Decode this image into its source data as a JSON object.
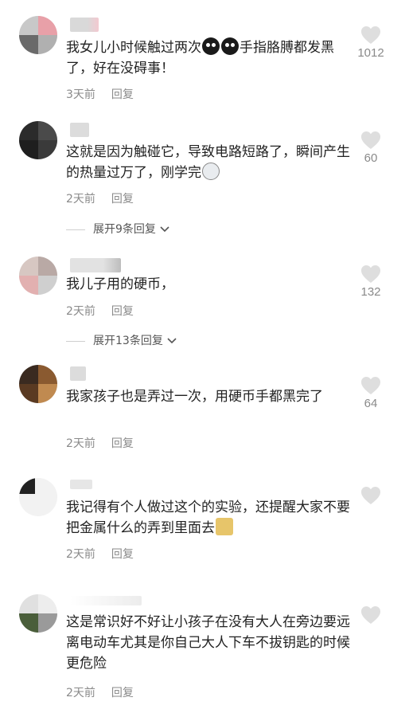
{
  "comments": [
    {
      "text_a": "我女儿小时候触过两次",
      "emoji_a": "crying-face-icon",
      "emoji_b": "crying-face-icon",
      "text_b": "手指胳膊都发黑了，好在没碍事！",
      "time": "3天前",
      "reply": "回复",
      "likes": "1012"
    },
    {
      "text_a": "这就是因为触碰它，导致电路短路了，瞬间产生的热量过万了，刚学完",
      "emoji_a": "husky-face-icon",
      "time": "2天前",
      "reply": "回复",
      "likes": "60",
      "expand": "展开9条回复"
    },
    {
      "text_a": "我儿子用的硬币，",
      "time": "2天前",
      "reply": "回复",
      "likes": "132",
      "expand": "展开13条回复"
    },
    {
      "text_a": "我家孩子也是弄过一次，用硬币手都黑完了",
      "time": "2天前",
      "reply": "回复",
      "likes": "64"
    },
    {
      "text_a": "我记得有个人做过这个的实验，还提醒大家不要把金属什么的弄到里面去",
      "emoji_a": "cat-face-icon",
      "time": "2天前",
      "reply": "回复"
    },
    {
      "text_a": "这是常识好不好让小孩子在没有大人在旁边要远离电动车尤其是你自己大人下车不拔钥匙的时候更危险",
      "time": "2天前",
      "reply": "回复"
    }
  ],
  "icons": {
    "like": "heart-icon",
    "expand": "chevron-down-icon"
  },
  "colors": {
    "text": "#222222",
    "meta": "#8a8a8a",
    "heart": "#dedede"
  }
}
